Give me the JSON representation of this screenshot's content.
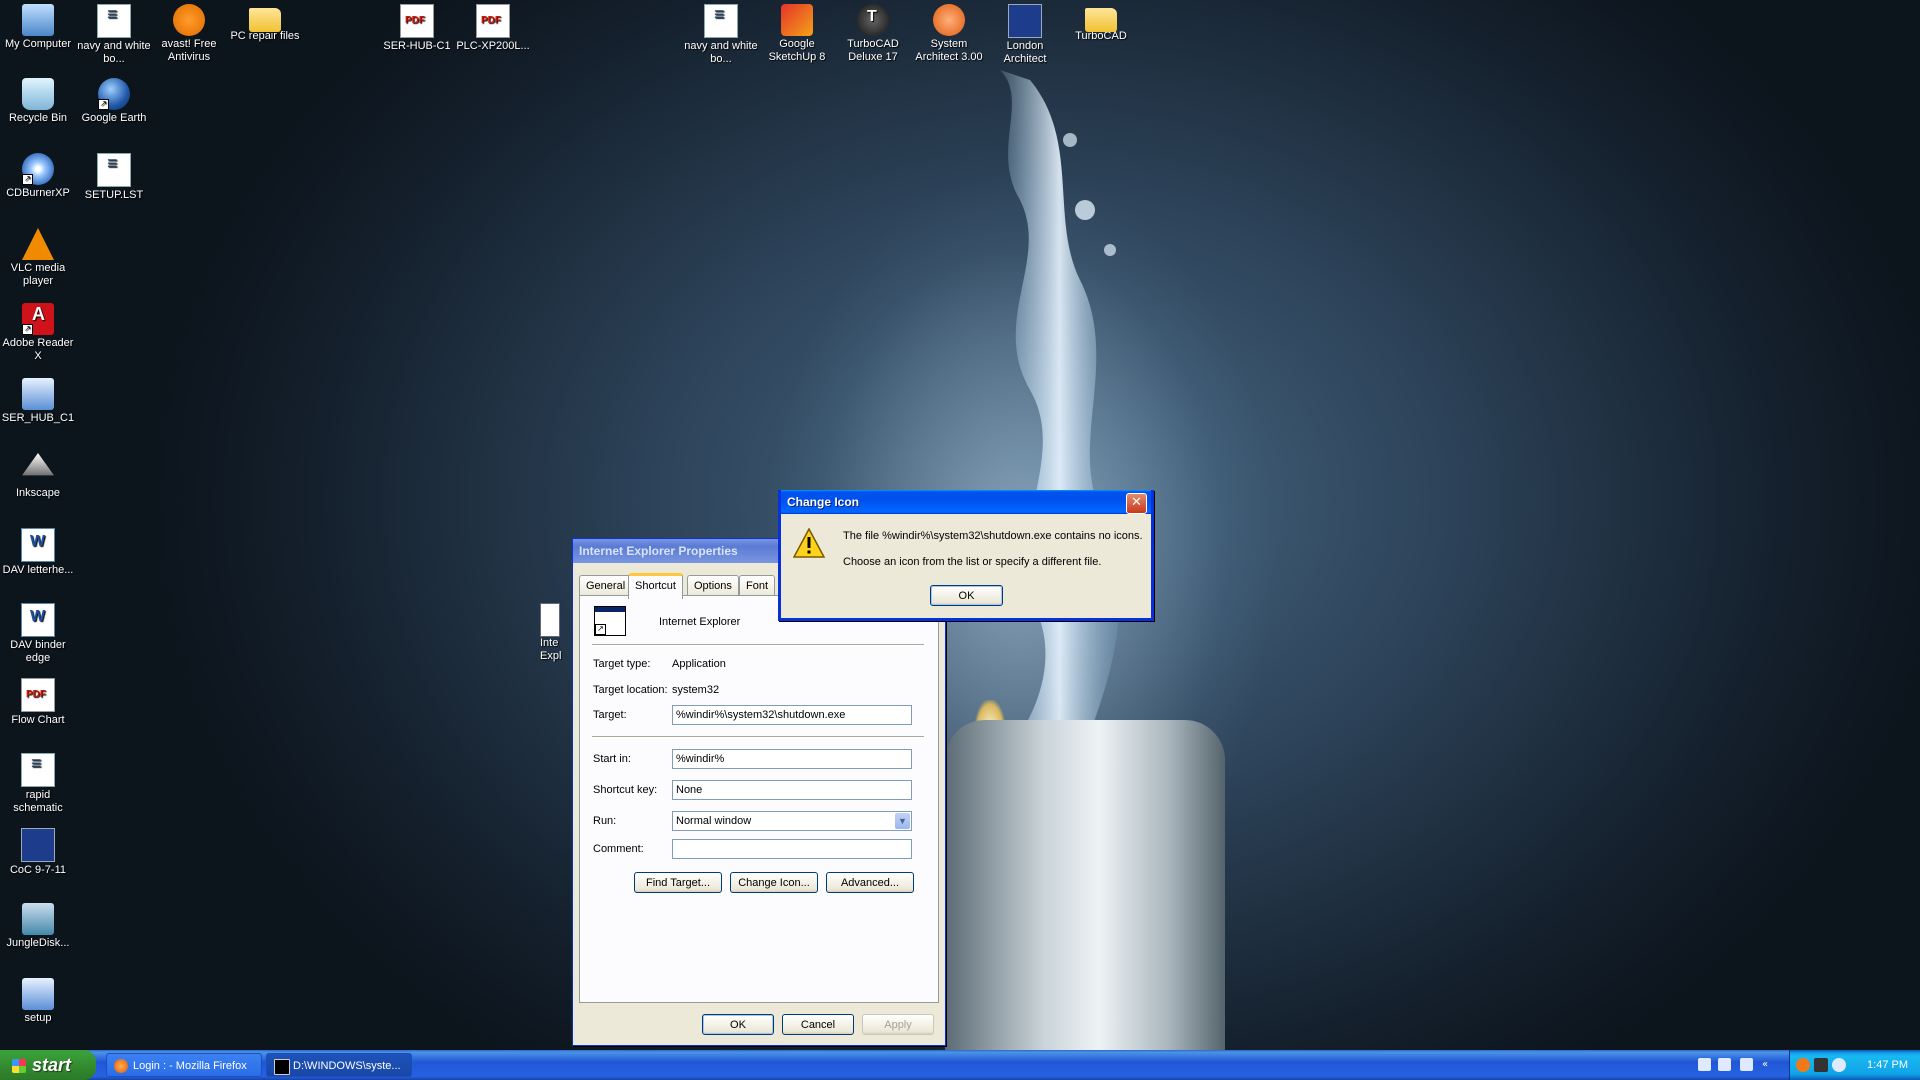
{
  "desktop": {
    "icons": [
      {
        "label": "My Computer"
      },
      {
        "label": "navy and white bo..."
      },
      {
        "label": "avast! Free Antivirus"
      },
      {
        "label": "PC repair files"
      },
      {
        "label": "SER-HUB-C1"
      },
      {
        "label": "PLC-XP200L..."
      },
      {
        "label": "navy and white bo..."
      },
      {
        "label": "Google SketchUp 8"
      },
      {
        "label": "TurboCAD Deluxe 17"
      },
      {
        "label": "System Architect 3.00"
      },
      {
        "label": "London Architect"
      },
      {
        "label": "TurboCAD"
      },
      {
        "label": "Recycle Bin"
      },
      {
        "label": "Google Earth"
      },
      {
        "label": "CDBurnerXP"
      },
      {
        "label": "SETUP.LST"
      },
      {
        "label": "VLC media player"
      },
      {
        "label": "Adobe Reader X"
      },
      {
        "label": "SER_HUB_C1"
      },
      {
        "label": "Inkscape"
      },
      {
        "label": "DAV letterhe..."
      },
      {
        "label": "DAV binder edge"
      },
      {
        "label": "Flow Chart"
      },
      {
        "label": "rapid schematic"
      },
      {
        "label": "CoC 9-7-11"
      },
      {
        "label": "JungleDisk..."
      },
      {
        "label": "setup"
      },
      {
        "label": "Inte Expl"
      }
    ]
  },
  "properties_dialog": {
    "title": "Internet Explorer Properties",
    "tabs": [
      "General",
      "Shortcut",
      "Options",
      "Font"
    ],
    "app_name": "Internet Explorer",
    "target_type_label": "Target type:",
    "target_type_value": "Application",
    "target_location_label": "Target location:",
    "target_location_value": "system32",
    "target_label": "Target:",
    "target_value": "%windir%\\system32\\shutdown.exe",
    "start_in_label": "Start in:",
    "start_in_value": "%windir%",
    "shortcut_key_label": "Shortcut key:",
    "shortcut_key_value": "None",
    "run_label": "Run:",
    "run_value": "Normal window",
    "comment_label": "Comment:",
    "comment_value": "",
    "find_target": "Find Target...",
    "change_icon": "Change Icon...",
    "advanced": "Advanced...",
    "ok": "OK",
    "cancel": "Cancel",
    "apply": "Apply"
  },
  "change_icon_dialog": {
    "title": "Change Icon",
    "message_line1": "The file %windir%\\system32\\shutdown.exe contains no icons.",
    "message_line2": "Choose an icon from the list or specify a different file.",
    "ok": "OK"
  },
  "taskbar": {
    "start_label": "start",
    "tasks": [
      {
        "label": "Login : - Mozilla Firefox"
      },
      {
        "label": "D:\\WINDOWS\\syste..."
      }
    ],
    "clock": "1:47 PM"
  },
  "colors": {
    "title_active": "#0053ee",
    "title_inactive": "#7a96df",
    "dialog_face": "#ece9d8",
    "taskbar": "#2157d7",
    "start_button": "#3aa03a"
  }
}
